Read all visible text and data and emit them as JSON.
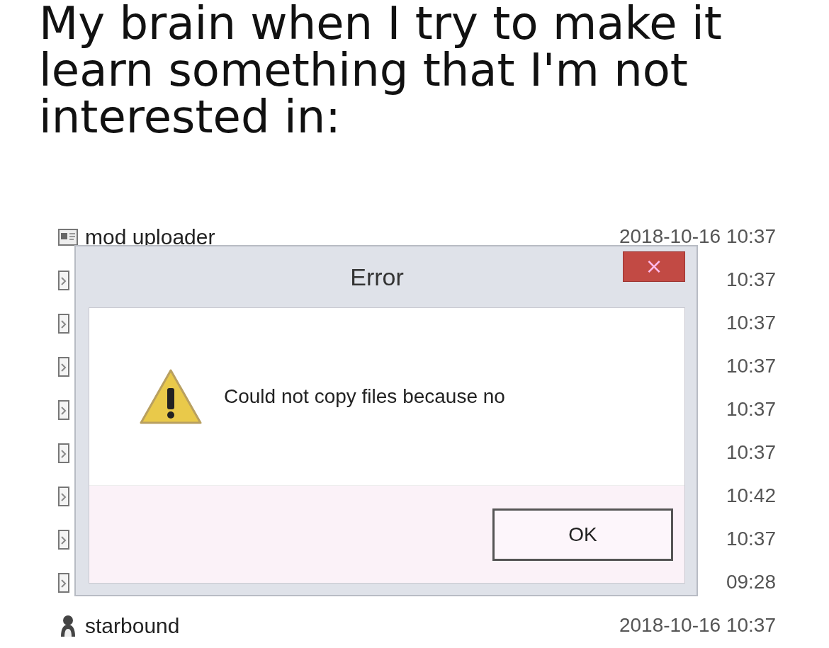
{
  "caption": "My brain when I try to make it learn something that I'm not interested in:",
  "files": [
    {
      "kind": "app",
      "name": "mod uploader",
      "modified": "2018-10-16 10:37"
    },
    {
      "kind": "file",
      "modified": "10:37"
    },
    {
      "kind": "file",
      "modified": "10:37"
    },
    {
      "kind": "file",
      "modified": "10:37"
    },
    {
      "kind": "file",
      "modified": "10:37"
    },
    {
      "kind": "file",
      "modified": "10:37"
    },
    {
      "kind": "file",
      "modified": "10:42"
    },
    {
      "kind": "file",
      "modified": "10:37"
    },
    {
      "kind": "file",
      "modified": "09:28"
    },
    {
      "kind": "person",
      "name": "starbound",
      "modified": "2018-10-16 10:37"
    }
  ],
  "dialog": {
    "title": "Error",
    "close": "×",
    "message": "Could not copy files because no",
    "buttons": [
      "OK"
    ]
  }
}
